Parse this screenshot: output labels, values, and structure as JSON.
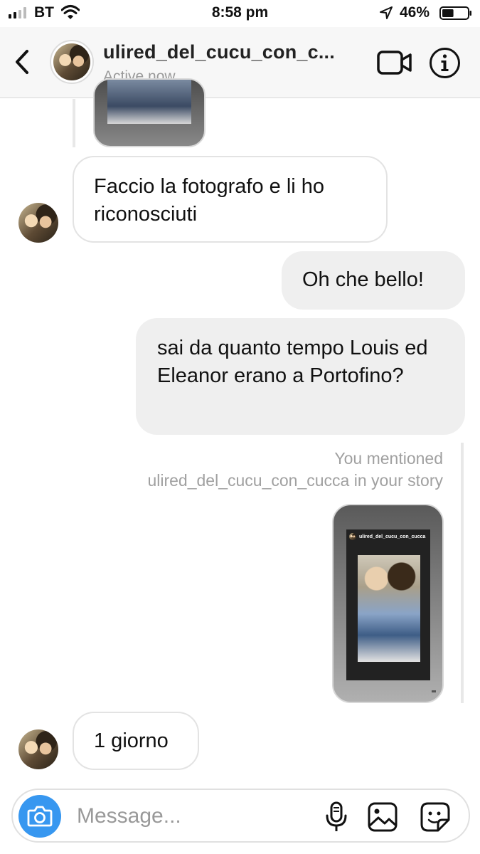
{
  "status_bar": {
    "carrier": "BT",
    "time": "8:58 pm",
    "battery_percent": "46%",
    "battery_level": 0.46,
    "icons": [
      "signal-icon",
      "wifi-icon",
      "location-arrow-icon",
      "battery-icon"
    ]
  },
  "header": {
    "username": "ulired_del_cucu_con_c...",
    "status": "Active now",
    "icons": [
      "back-icon",
      "video-call-icon",
      "info-icon"
    ]
  },
  "messages": [
    {
      "direction": "in",
      "text": "Faccio la fotografo e li ho riconosciuti"
    },
    {
      "direction": "out",
      "text": "Oh che bello!"
    },
    {
      "direction": "out",
      "text": "sai da quanto tempo Louis ed Eleanor erano a Portofino?"
    },
    {
      "direction": "in",
      "text": "1 giorno"
    }
  ],
  "mention": {
    "line1": "You mentioned",
    "line2": "ulired_del_cucu_con_cucca in your story"
  },
  "story_preview": {
    "username": "ulired_del_cucu_con_cucca"
  },
  "composer": {
    "placeholder": "Message...",
    "value": "",
    "icons": [
      "camera-icon",
      "microphone-icon",
      "gallery-icon",
      "sticker-icon"
    ]
  },
  "colors": {
    "accent": "#3797f0",
    "outgoing_bubble": "#efefef",
    "incoming_border": "#e3e3e3",
    "secondary_text": "#999999"
  }
}
